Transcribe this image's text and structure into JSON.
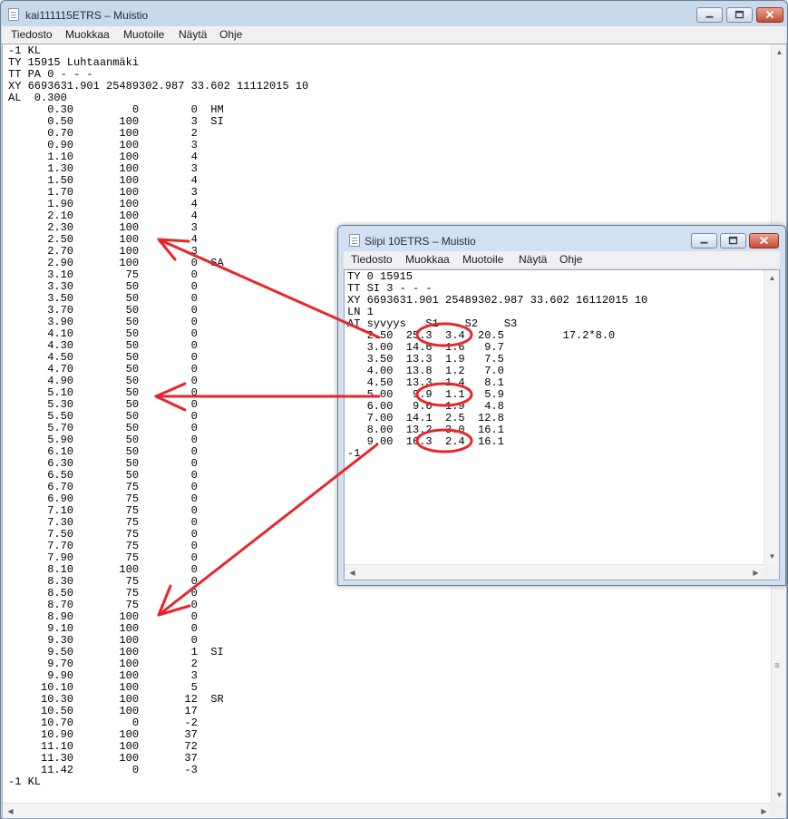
{
  "main_window": {
    "title": "kai111115ETRS – Muistio",
    "menu": [
      "Tiedosto",
      "Muokkaa",
      "Muotoile",
      "Näytä",
      "Ohje"
    ],
    "lines": [
      "-1 KL",
      "TY 15915 Luhtaanmäki",
      "TT PA 0 - - -",
      "XY 6693631.901 25489302.987 33.602 11112015 10",
      "AL  0.300",
      "      0.30         0        0  HM",
      "      0.50       100        3  SI",
      "      0.70       100        2",
      "      0.90       100        3",
      "      1.10       100        4",
      "      1.30       100        3",
      "      1.50       100        4",
      "      1.70       100        3",
      "      1.90       100        4",
      "      2.10       100        4",
      "      2.30       100        3",
      "      2.50       100        4",
      "      2.70       100        3",
      "      2.90       100        0  SA",
      "      3.10        75        0",
      "      3.30        50        0",
      "      3.50        50        0",
      "      3.70        50        0",
      "      3.90        50        0",
      "      4.10        50        0",
      "      4.30        50        0",
      "      4.50        50        0",
      "      4.70        50        0",
      "      4.90        50        0",
      "      5.10        50        0",
      "      5.30        50        0",
      "      5.50        50        0",
      "      5.70        50        0",
      "      5.90        50        0",
      "      6.10        50        0",
      "      6.30        50        0",
      "      6.50        50        0",
      "      6.70        75        0",
      "      6.90        75        0",
      "      7.10        75        0",
      "      7.30        75        0",
      "      7.50        75        0",
      "      7.70        75        0",
      "      7.90        75        0",
      "      8.10       100        0",
      "      8.30        75        0",
      "      8.50        75        0",
      "      8.70        75        0",
      "      8.90       100        0",
      "      9.10       100        0",
      "      9.30       100        0",
      "      9.50       100        1  SI",
      "      9.70       100        2",
      "      9.90       100        3",
      "     10.10       100        5",
      "     10.30       100       12  SR",
      "     10.50       100       17",
      "     10.70         0       -2",
      "     10.90       100       37",
      "     11.10       100       72",
      "     11.30       100       37",
      "     11.42         0       -3",
      "-1 KL"
    ]
  },
  "popup_window": {
    "title": "Siipi 10ETRS – Muistio",
    "menu": [
      "Tiedosto",
      "Muokkaa",
      "Muotoile",
      "Näytä",
      "Ohje"
    ],
    "lines": [
      "TY 0 15915",
      "TT SI 3 - - -",
      "XY 6693631.901 25489302.987 33.602 16112015 10",
      "LN 1",
      "AT syvyys   S1    S2    S3",
      "   2.50  25.3  3.4  20.5         17.2*8.0",
      "   3.00  14.6  1.6   9.7",
      "   3.50  13.3  1.9   7.5",
      "   4.00  13.8  1.2   7.0",
      "   4.50  13.3  1.4   8.1",
      "   5.00   9.9  1.1   5.9",
      "   6.00   9.6  1.9   4.8",
      "   7.00  14.1  2.5  12.8",
      "   8.00  13.2  3.0  16.1",
      "   9.00  16.3  2.4  16.1",
      "-1"
    ]
  },
  "annotation": {
    "color": "#e8252b"
  },
  "icons": {
    "minimize": "minimize-icon",
    "maximize": "maximize-icon",
    "close": "close-icon",
    "app": "notepad-icon"
  }
}
